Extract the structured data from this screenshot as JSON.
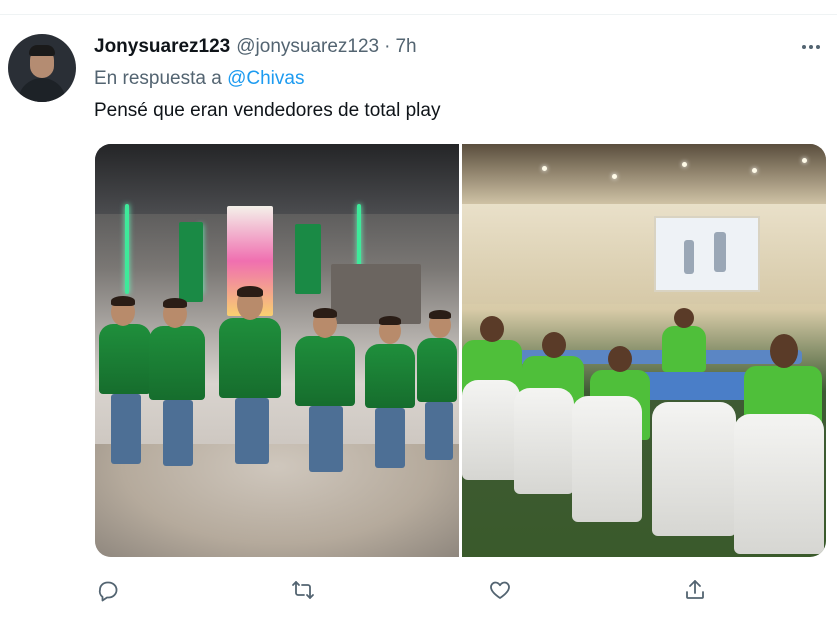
{
  "tweet": {
    "author_name": "Jonysuarez123",
    "author_handle": "@jonysuarez123",
    "separator": "·",
    "timestamp": "7h",
    "reply_prefix": "En respuesta a",
    "reply_mention": "@Chivas",
    "text": "Pensé que eran vendedores de total play"
  },
  "media": {
    "images": [
      {
        "description_icon": "photo-players-store"
      },
      {
        "description_icon": "photo-conference-room"
      }
    ]
  },
  "actions": [
    {
      "name": "reply",
      "icon": "reply-icon"
    },
    {
      "name": "retweet",
      "icon": "retweet-icon"
    },
    {
      "name": "like",
      "icon": "like-icon"
    },
    {
      "name": "share",
      "icon": "share-icon"
    }
  ],
  "colors": {
    "text_primary": "#0f1419",
    "text_secondary": "#536471",
    "link": "#1d9bf0"
  }
}
